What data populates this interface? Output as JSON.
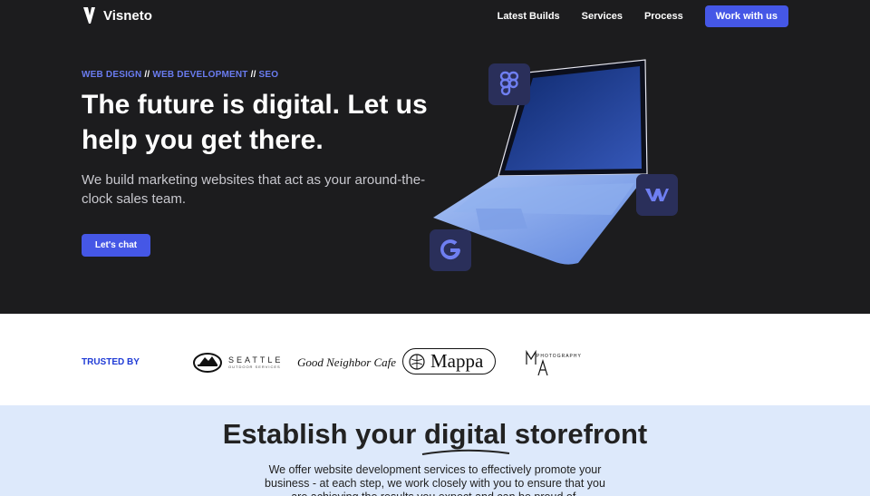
{
  "brand": {
    "name": "Visneto"
  },
  "nav": {
    "links": [
      "Latest Builds",
      "Services",
      "Process"
    ],
    "cta": "Work with us"
  },
  "hero": {
    "eyebrow": [
      "WEB DESIGN",
      " // ",
      "WEB DEVELOPMENT",
      " // ",
      "SEO"
    ],
    "headline": "The future is digital. Let us help you get there.",
    "sub": "We build marketing websites that act as your around-the-clock sales team.",
    "cta": "Let's chat",
    "icons": [
      "figma-icon",
      "webflow-icon",
      "google-icon",
      "laptop-illustration"
    ]
  },
  "trusted": {
    "label": "TRUSTED BY",
    "logos": {
      "seattle_big": "SEATTLE",
      "seattle_small": "OUTDOOR SERVICES",
      "gnc": "Good Neighbor Cafe",
      "mappa": "Mappa",
      "ma_small": "PHOTOGRAPHY"
    }
  },
  "store": {
    "title_pre": "Establish your ",
    "title_mid": "digital",
    "title_post": " storefront",
    "body": "We offer website development services to effectively promote your business - at each step, we work closely with you to ensure that you are achieving the results you expect and can be proud of."
  },
  "colors": {
    "hero_bg": "#1c1c1e",
    "accent": "#4557e6",
    "trusted_label": "#1f3bd6",
    "store_bg": "#dde9fb"
  }
}
